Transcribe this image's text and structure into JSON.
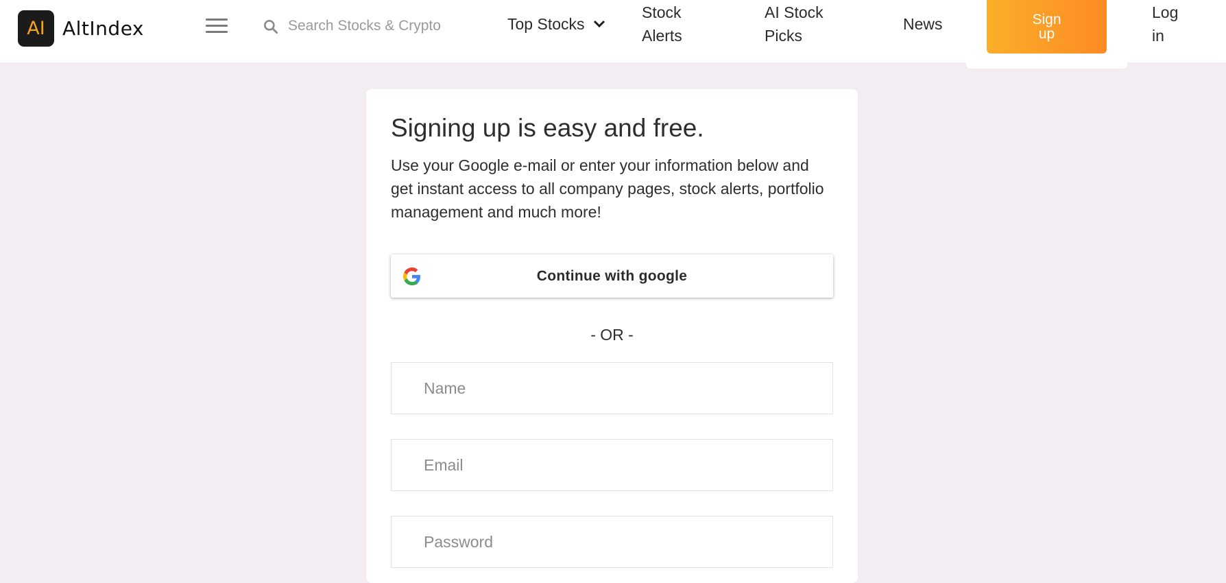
{
  "header": {
    "logo_badge": "AI",
    "logo_text": "AltIndex",
    "search_placeholder": "Search Stocks & Crypto",
    "nav": {
      "top_stocks": "Top Stocks",
      "stock_alerts": "Stock Alerts",
      "ai_stock_picks": "AI Stock Picks",
      "news": "News",
      "sign_up": "Sign up",
      "log_in": "Log in"
    },
    "icons": {
      "menu": "hamburger-menu-icon",
      "search": "search-icon",
      "dropdown": "chevron-down-icon"
    },
    "colors": {
      "accent_start": "#fbae2a",
      "accent_end": "#fd8b24",
      "logo_accent": "#f7a21b"
    }
  },
  "signup_card": {
    "title": "Signing up is easy and free.",
    "description": "Use your Google e-mail or enter your information below and get instant access to all company pages, stock alerts, portfolio management and much more!",
    "google_button": "Continue with google",
    "or_divider": "- OR -",
    "fields": {
      "name_placeholder": "Name",
      "email_placeholder": "Email",
      "password_placeholder": "Password"
    }
  }
}
